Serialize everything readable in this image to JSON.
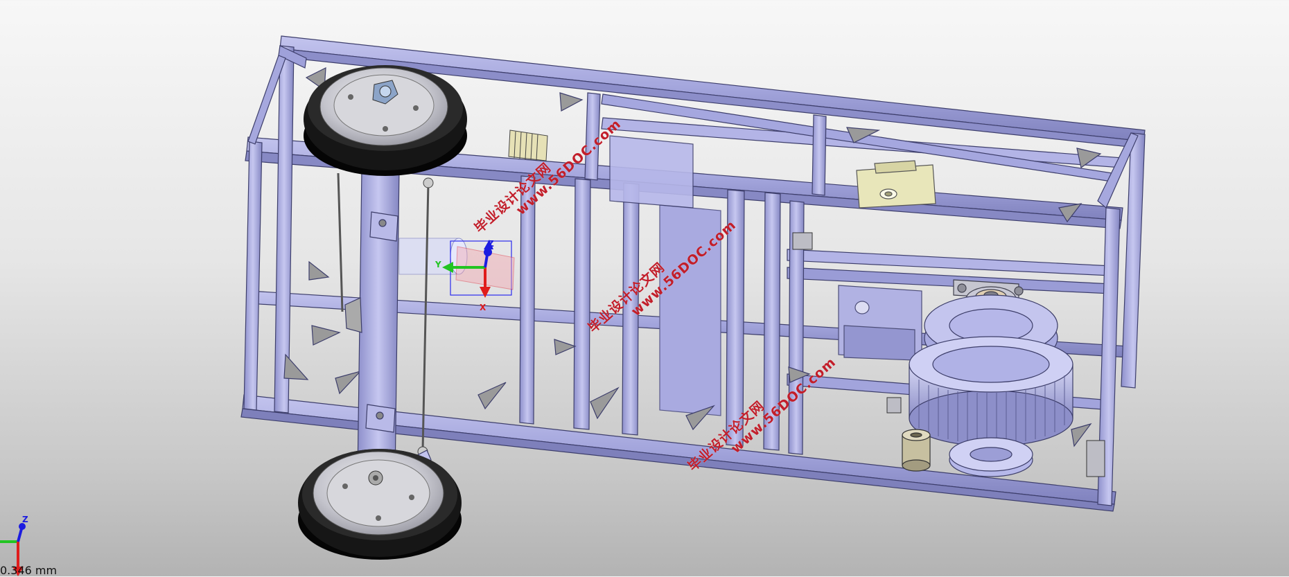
{
  "viewport": {
    "background_top": "#f7f7f7",
    "background_bottom": "#b3b3b3",
    "frame_color": "#a6a8de",
    "frame_edge": "#3d3e6b",
    "tire_color": "#111111",
    "hub_color": "#c9c9cf"
  },
  "watermarks": [
    {
      "cn": "毕业设计论文网",
      "url": "www.56DOC.com"
    },
    {
      "cn": "毕业设计论文网",
      "url": "www.56DOC.com"
    },
    {
      "cn": "毕业设计论文网",
      "url": "www.56DOC.com"
    }
  ],
  "gizmo": {
    "x": "X",
    "y": "Y",
    "z": "Z"
  },
  "triad": {
    "z": "Z"
  },
  "scale_bar": {
    "label": "0.346 mm"
  }
}
